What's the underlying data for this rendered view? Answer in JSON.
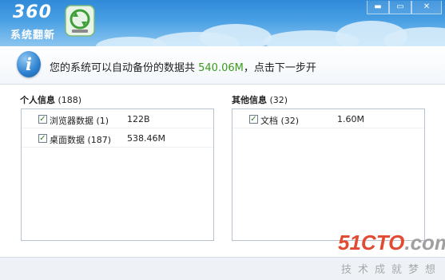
{
  "app": {
    "logo_text": "360",
    "logo_subtitle": "系统翻新",
    "window_controls": [
      "▬",
      "▭",
      "✕"
    ]
  },
  "banner": {
    "text_prefix": "您的系统可以自动备份的数据共 ",
    "amount": "540.06M",
    "text_suffix": "，点击下一步开"
  },
  "personal": {
    "title": "个人信息",
    "count": "(188)",
    "items": [
      {
        "label": "浏览器数据 (1)",
        "size": "122B",
        "checked": true
      },
      {
        "label": "桌面数据 (187)",
        "size": "538.46M",
        "checked": true
      }
    ]
  },
  "other": {
    "title": "其他信息",
    "count": "(32)",
    "items": [
      {
        "label": "文档 (32)",
        "size": "1.60M",
        "checked": true
      }
    ]
  },
  "watermark": {
    "main_red": "51CTO",
    "main_gray": ".com",
    "sub": "技术成就梦想"
  },
  "colors": {
    "header": "#3a92dc",
    "amount": "#3b9c1c",
    "watermark_red": "#e24b33"
  }
}
